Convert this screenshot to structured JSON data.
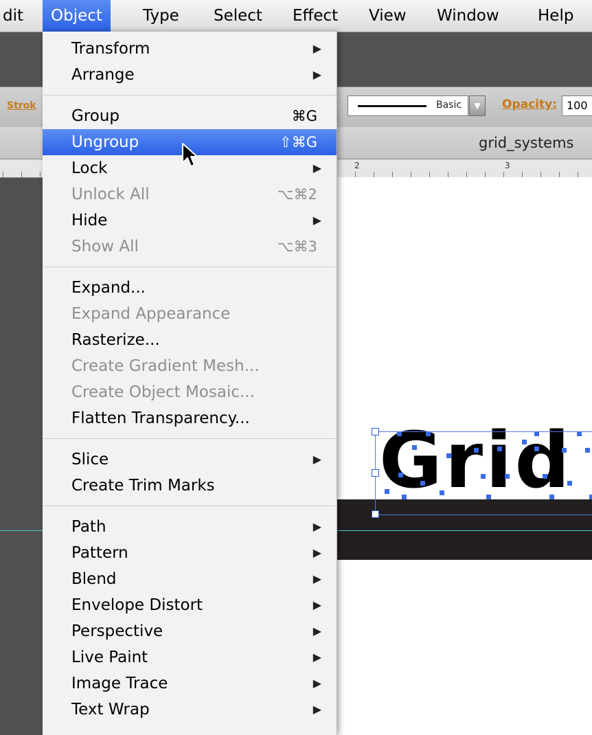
{
  "menubar": {
    "items": [
      "dit",
      "Object",
      "Type",
      "Select",
      "Effect",
      "View",
      "Window",
      "Help"
    ],
    "active": "Object"
  },
  "control_bar": {
    "stroke_label": "Strok",
    "brush_label": "Basic",
    "opacity_label": "Opacity:",
    "opacity_value": "100"
  },
  "document": {
    "title": "grid_systems",
    "ruler_numbers": [
      "2",
      "3"
    ]
  },
  "canvas": {
    "artwork_text": "Grid"
  },
  "menu": {
    "groups": [
      [
        {
          "label": "Transform",
          "submenu": true
        },
        {
          "label": "Arrange",
          "submenu": true
        }
      ],
      [
        {
          "label": "Group",
          "shortcut": "⌘G"
        },
        {
          "label": "Ungroup",
          "shortcut": "⇧⌘G",
          "highlighted": true
        },
        {
          "label": "Lock",
          "submenu": true
        },
        {
          "label": "Unlock All",
          "shortcut": "⌥⌘2",
          "disabled": true
        },
        {
          "label": "Hide",
          "submenu": true
        },
        {
          "label": "Show All",
          "shortcut": "⌥⌘3",
          "disabled": true
        }
      ],
      [
        {
          "label": "Expand..."
        },
        {
          "label": "Expand Appearance",
          "disabled": true
        },
        {
          "label": "Rasterize..."
        },
        {
          "label": "Create Gradient Mesh...",
          "disabled": true
        },
        {
          "label": "Create Object Mosaic...",
          "disabled": true
        },
        {
          "label": "Flatten Transparency..."
        }
      ],
      [
        {
          "label": "Slice",
          "submenu": true
        },
        {
          "label": "Create Trim Marks"
        }
      ],
      [
        {
          "label": "Path",
          "submenu": true
        },
        {
          "label": "Pattern",
          "submenu": true
        },
        {
          "label": "Blend",
          "submenu": true
        },
        {
          "label": "Envelope Distort",
          "submenu": true
        },
        {
          "label": "Perspective",
          "submenu": true
        },
        {
          "label": "Live Paint",
          "submenu": true
        },
        {
          "label": "Image Trace",
          "submenu": true
        },
        {
          "label": "Text Wrap",
          "submenu": true
        }
      ]
    ],
    "submenu_glyph": "▶"
  },
  "colors": {
    "highlight": "#2b61e5",
    "disabled_text": "#8f8f8f",
    "accent_label": "#c47a1a",
    "guide": "#4cc9d6"
  },
  "icons": {
    "pointer": "arrow-cursor-icon",
    "submenu": "triangle-right-icon"
  }
}
